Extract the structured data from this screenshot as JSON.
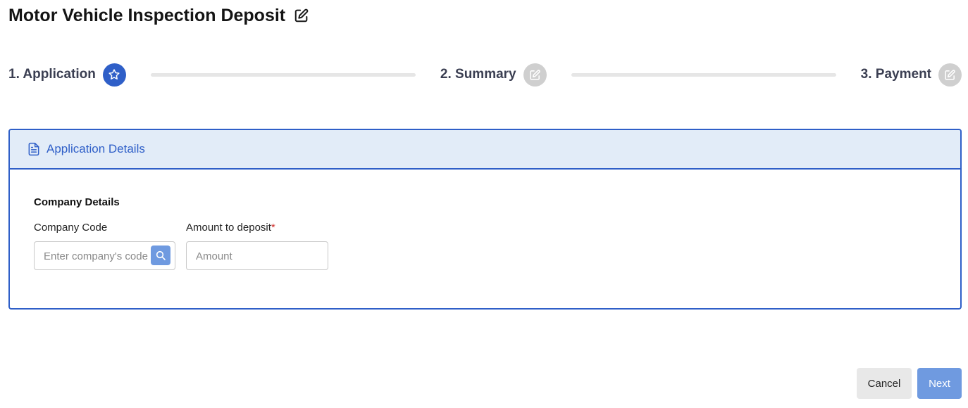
{
  "header": {
    "title": "Motor Vehicle Inspection Deposit",
    "edit_icon": "edit-icon"
  },
  "stepper": {
    "steps": [
      {
        "label": "1. Application",
        "state": "active",
        "icon": "star-icon"
      },
      {
        "label": "2. Summary",
        "state": "inactive",
        "icon": "edit-icon"
      },
      {
        "label": "3. Payment",
        "state": "inactive",
        "icon": "edit-icon"
      }
    ]
  },
  "card": {
    "header_title": "Application Details",
    "header_icon": "document-icon",
    "section_title": "Company Details",
    "fields": {
      "company_code": {
        "label": "Company Code",
        "placeholder": "Enter company's code",
        "value": ""
      },
      "amount": {
        "label": "Amount to deposit",
        "required_mark": "*",
        "placeholder": "Amount",
        "value": ""
      }
    }
  },
  "footer": {
    "cancel_label": "Cancel",
    "next_label": "Next"
  },
  "colors": {
    "primary": "#2f5fc8",
    "primary_light": "#6f9ae0",
    "header_bg": "#e2ecf8",
    "inactive": "#cfcfcf",
    "required": "#d0312d"
  }
}
